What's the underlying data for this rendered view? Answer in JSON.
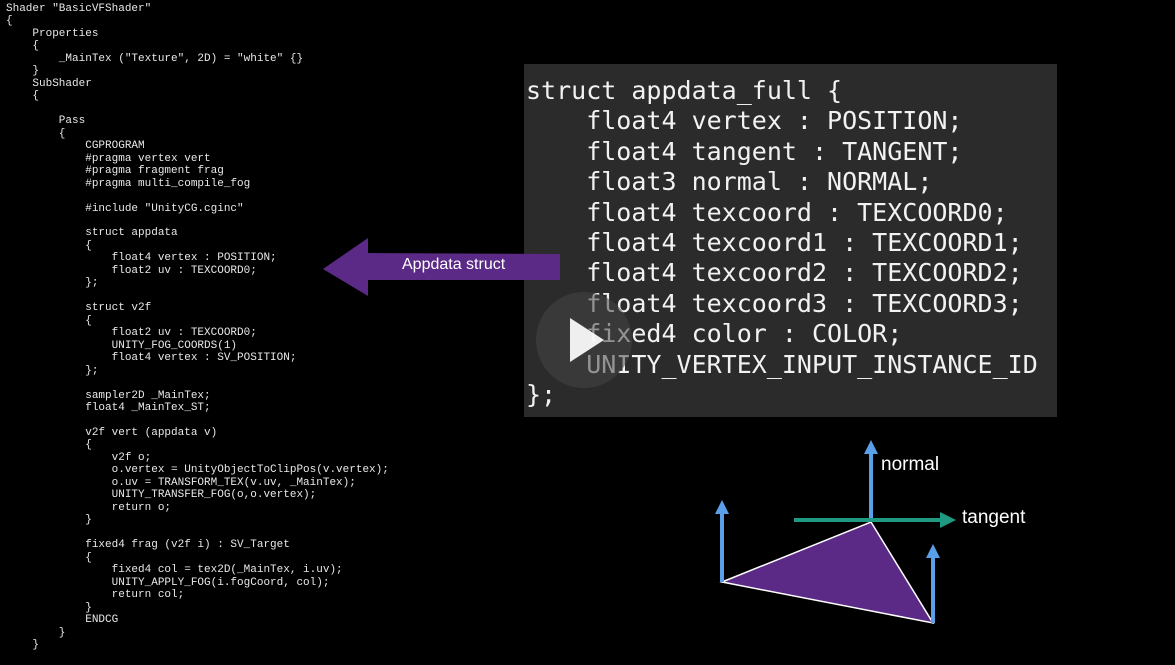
{
  "code_lines": [
    "Shader \"BasicVFShader\"",
    "{",
    "    Properties",
    "    {",
    "        _MainTex (\"Texture\", 2D) = \"white\" {}",
    "    }",
    "    SubShader",
    "    {",
    "",
    "        Pass",
    "        {",
    "            CGPROGRAM",
    "            #pragma vertex vert",
    "            #pragma fragment frag",
    "            #pragma multi_compile_fog",
    "",
    "            #include \"UnityCG.cginc\"",
    "",
    "            struct appdata",
    "            {",
    "                float4 vertex : POSITION;",
    "                float2 uv : TEXCOORD0;",
    "            };",
    "",
    "            struct v2f",
    "            {",
    "                float2 uv : TEXCOORD0;",
    "                UNITY_FOG_COORDS(1)",
    "                float4 vertex : SV_POSITION;",
    "            };",
    "",
    "            sampler2D _MainTex;",
    "            float4 _MainTex_ST;",
    "",
    "            v2f vert (appdata v)",
    "            {",
    "                v2f o;",
    "                o.vertex = UnityObjectToClipPos(v.vertex);",
    "                o.uv = TRANSFORM_TEX(v.uv, _MainTex);",
    "                UNITY_TRANSFER_FOG(o,o.vertex);",
    "                return o;",
    "            }",
    "",
    "            fixed4 frag (v2f i) : SV_Target",
    "            {",
    "                fixed4 col = tex2D(_MainTex, i.uv);",
    "                UNITY_APPLY_FOG(i.fogCoord, col);",
    "                return col;",
    "            }",
    "            ENDCG",
    "        }",
    "    }"
  ],
  "callout": {
    "label": "Appdata struct",
    "color": "#5b2a86"
  },
  "struct_lines": [
    "struct appdata_full {",
    "    float4 vertex : POSITION;",
    "    float4 tangent : TANGENT;",
    "    float3 normal : NORMAL;",
    "    float4 texcoord : TEXCOORD0;",
    "    float4 texcoord1 : TEXCOORD1;",
    "    float4 texcoord2 : TEXCOORD2;",
    "    float4 texcoord3 : TEXCOORD3;",
    "    fixed4 color : COLOR;",
    "    UNITY_VERTEX_INPUT_INSTANCE_ID",
    "};"
  ],
  "diagram": {
    "normal_label": "normal",
    "tangent_label": "tangent",
    "triangle_color": "#5b2a86",
    "normal_color": "#5aa0e8",
    "tangent_color": "#1e9a82"
  },
  "player": {
    "icon": "play-icon"
  }
}
